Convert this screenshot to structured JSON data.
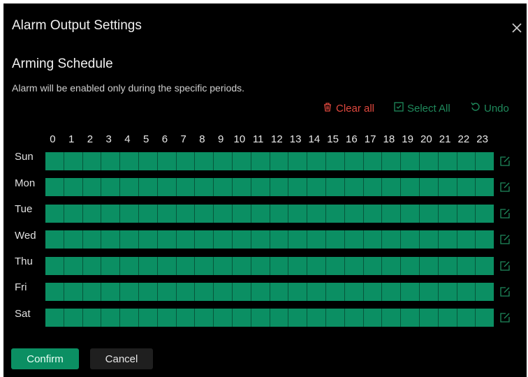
{
  "dialog": {
    "title": "Alarm Output Settings",
    "close_icon": "close-icon"
  },
  "schedule": {
    "section_title": "Arming Schedule",
    "description": "Alarm will be enabled only during the specific periods.",
    "toolbar": {
      "clear_all": "Clear all",
      "select_all": "Select All",
      "undo": "Undo"
    },
    "hours": [
      "0",
      "1",
      "2",
      "3",
      "4",
      "5",
      "6",
      "7",
      "8",
      "9",
      "10",
      "11",
      "12",
      "13",
      "14",
      "15",
      "16",
      "17",
      "18",
      "19",
      "20",
      "21",
      "22",
      "23"
    ],
    "days": [
      "Sun",
      "Mon",
      "Tue",
      "Wed",
      "Thu",
      "Fri",
      "Sat"
    ],
    "armed_hours_per_day": 24,
    "edit_icon": "edit-icon"
  },
  "buttons": {
    "confirm": "Confirm",
    "cancel": "Cancel"
  },
  "colors": {
    "background": "#000000",
    "accent_green": "#0b8f63",
    "grid_line": "#06563b",
    "danger_red": "#e0483e",
    "link_green": "#1f8a5c"
  }
}
